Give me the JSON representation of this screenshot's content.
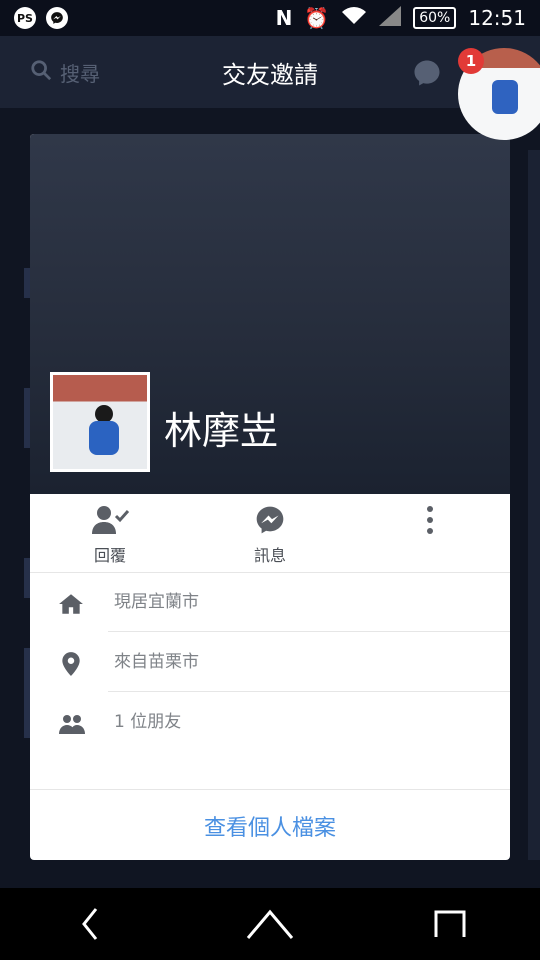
{
  "status_bar": {
    "left_icons": [
      "ps-app-icon",
      "messenger-icon"
    ],
    "right_icons": [
      "nfc-icon",
      "alarm-icon",
      "wifi-icon",
      "signal-icon"
    ],
    "ps_label": "PS",
    "battery": "60%",
    "time": "12:51"
  },
  "header": {
    "title": "交友邀請",
    "search_placeholder": "搜尋",
    "messenger_badge": "1"
  },
  "chathead": {
    "badge": "1"
  },
  "profile": {
    "name": "林摩岦",
    "actions": [
      {
        "label": "回覆",
        "icon": "respond-user-check-icon"
      },
      {
        "label": "訊息",
        "icon": "messenger-icon"
      },
      {
        "label": "",
        "icon": "more-vertical-icon"
      }
    ],
    "info": [
      {
        "icon": "home-icon",
        "text": "現居宜蘭市"
      },
      {
        "icon": "location-pin-icon",
        "text": "來自苗栗市"
      },
      {
        "icon": "friends-icon",
        "text": "1 位朋友"
      }
    ],
    "view_profile": "查看個人檔案"
  },
  "colors": {
    "link": "#4a90e2",
    "badge": "#e23a37",
    "header": "#1c2334"
  }
}
